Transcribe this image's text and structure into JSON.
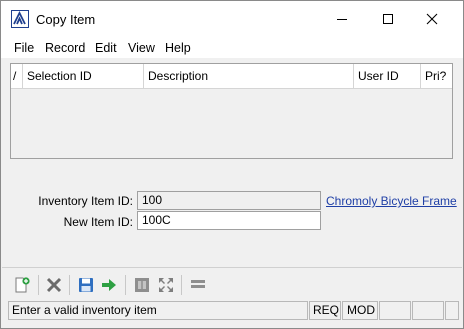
{
  "window": {
    "title": "Copy Item"
  },
  "menu": {
    "items": [
      "File",
      "Record",
      "Edit",
      "View",
      "Help"
    ]
  },
  "grid": {
    "columns": [
      "/",
      "Selection ID",
      "Description",
      "User ID",
      "Pri?"
    ],
    "rows": []
  },
  "form": {
    "inventory_item_label": "Inventory Item ID:",
    "inventory_item_value": "100",
    "inventory_item_link": "Chromoly Bicycle Frame",
    "new_item_label": "New Item ID:",
    "new_item_value": "100C"
  },
  "toolbar": {
    "buttons": [
      "new-icon",
      "delete-icon",
      "save-icon",
      "go-icon",
      "pin-icon",
      "expand-icon",
      "list-icon"
    ]
  },
  "status": {
    "message": "Enter a valid inventory item",
    "req": "REQ",
    "mod": "MOD"
  },
  "colors": {
    "link": "#1f3fa6",
    "accent": "#1f3f8f",
    "save": "#2f6fc0",
    "go": "#2ea043",
    "delete": "#6b6b6b"
  }
}
